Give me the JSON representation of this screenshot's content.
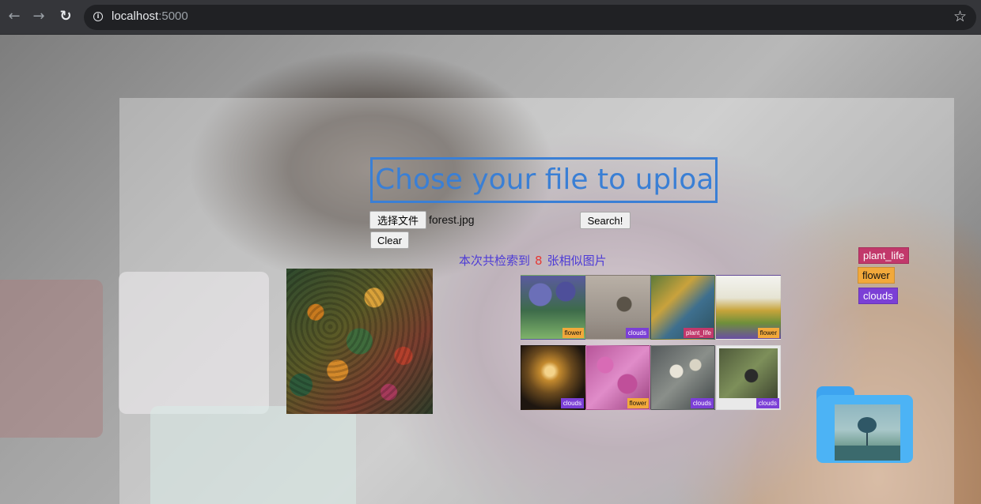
{
  "browser": {
    "back_icon": "arrow-left-icon",
    "forward_icon": "arrow-right-icon",
    "reload_icon": "reload-icon",
    "url_host": "localhost",
    "url_port": ":5000",
    "bookmark_icon": "star-icon"
  },
  "upload": {
    "title": "Chose your file to upload",
    "choose_file_label": "选择文件",
    "file_name": "forest.jpg",
    "search_label": "Search!",
    "clear_label": "Clear"
  },
  "results": {
    "prefix": "本次共检索到",
    "count": "8",
    "suffix": "张相似图片",
    "items": [
      {
        "tag": "flower"
      },
      {
        "tag": "clouds"
      },
      {
        "tag": "plant_life"
      },
      {
        "tag": "flower"
      },
      {
        "tag": "clouds"
      },
      {
        "tag": "flower"
      },
      {
        "tag": "clouds"
      },
      {
        "tag": "clouds"
      }
    ]
  },
  "legend": [
    {
      "label": "plant_life",
      "color": "#c2386b"
    },
    {
      "label": "flower",
      "color": "#f2a93b"
    },
    {
      "label": "clouds",
      "color": "#7b3fd6"
    }
  ],
  "colors": {
    "plant_life": "#c2386b",
    "flower": "#f2a93b",
    "clouds": "#7b3fd6",
    "title_blue": "#3a7fd5",
    "result_text": "#4d3bd6",
    "count_red": "#e53935"
  },
  "folder_icon": "folder-image-icon"
}
